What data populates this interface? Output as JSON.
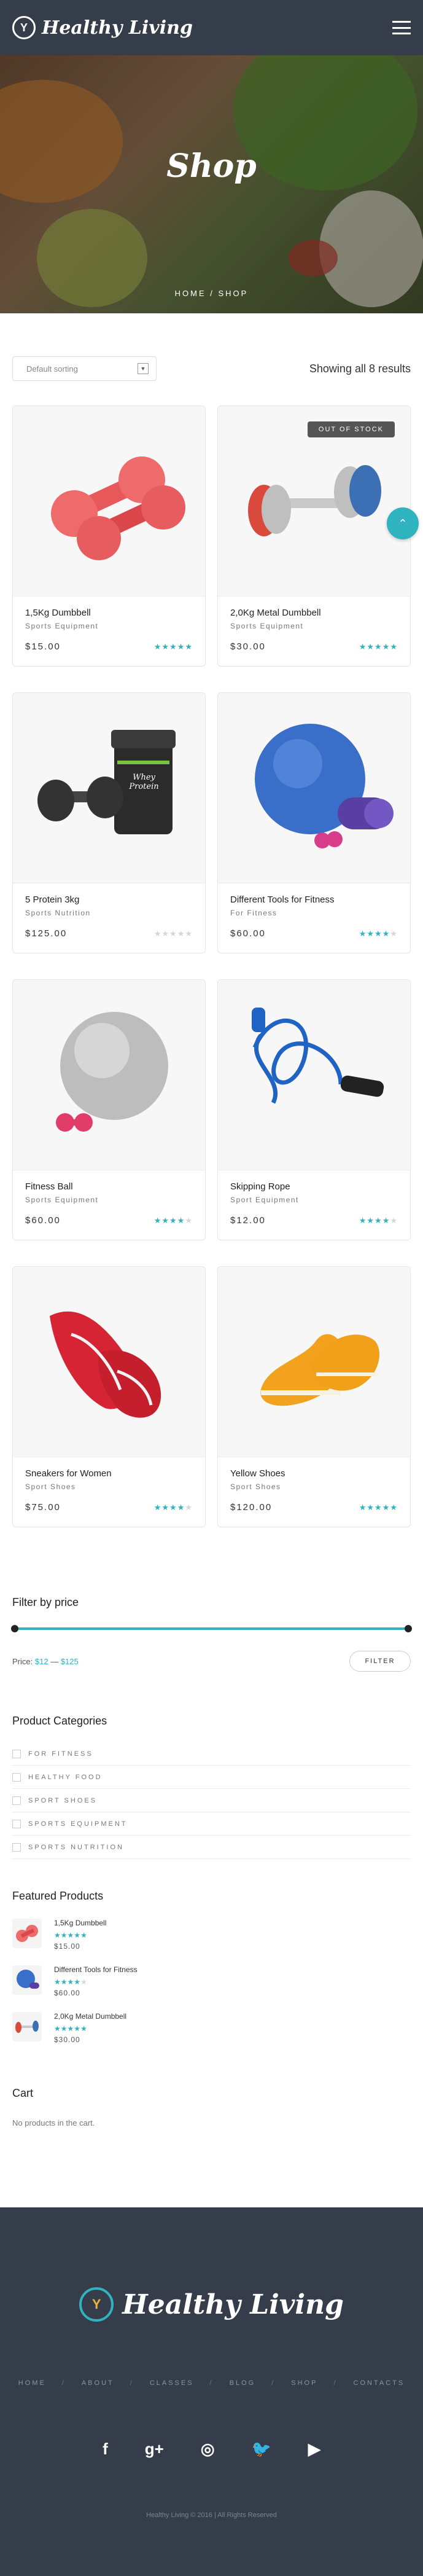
{
  "header": {
    "logo_text": "Healthy Living",
    "logo_mark": "Y",
    "menu_icon": "hamburger-icon"
  },
  "hero": {
    "title": "Shop",
    "breadcrumb": "HOME / SHOP"
  },
  "toolbar": {
    "sort_label": "Default sorting",
    "result_count": "Showing all 8 results"
  },
  "products": [
    {
      "name": "1,5Kg Dumbbell",
      "category": "Sports Equipment",
      "price": "$15.00",
      "rating": 5
    },
    {
      "name": "2,0Kg Metal Dumbbell",
      "category": "Sports Equipment",
      "price": "$30.00",
      "rating": 5,
      "badge": "OUT OF STOCK"
    },
    {
      "name": "5 Protein 3kg",
      "category": "Sports Nutrition",
      "price": "$125.00",
      "rating": 0
    },
    {
      "name": "Different Tools for Fitness",
      "category": "For Fitness",
      "price": "$60.00",
      "rating": 4
    },
    {
      "name": "Fitness Ball",
      "category": "Sports Equipment",
      "price": "$60.00",
      "rating": 4
    },
    {
      "name": "Skipping Rope",
      "category": "Sport Equipment",
      "price": "$12.00",
      "rating": 4
    },
    {
      "name": "Sneakers for Women",
      "category": "Sport Shoes",
      "price": "$75.00",
      "rating": 4
    },
    {
      "name": "Yellow Shoes",
      "category": "Sport Shoes",
      "price": "$120.00",
      "rating": 5
    }
  ],
  "protein_label": "Whey Protein",
  "filter": {
    "title": "Filter by price",
    "price_prefix": "Price:",
    "min": "$12",
    "dash": "—",
    "max": "$125",
    "button": "FILTER"
  },
  "categories": {
    "title": "Product Categories",
    "items": [
      "FOR FITNESS",
      "HEALTHY FOOD",
      "SPORT SHOES",
      "SPORTS EQUIPMENT",
      "SPORTS NUTRITION"
    ]
  },
  "featured": {
    "title": "Featured Products",
    "items": [
      {
        "name": "1,5Kg Dumbbell",
        "price": "$15.00",
        "rating": 5
      },
      {
        "name": "Different Tools for Fitness",
        "price": "$60.00",
        "rating": 4
      },
      {
        "name": "2,0Kg Metal Dumbbell",
        "price": "$30.00",
        "rating": 5
      }
    ]
  },
  "cart": {
    "title": "Cart",
    "empty": "No products in the cart."
  },
  "footer": {
    "logo_text": "Healthy Living",
    "logo_mark": "Y",
    "nav": [
      "HOME",
      "ABOUT",
      "CLASSES",
      "BLOG",
      "SHOP",
      "CONTACTS"
    ],
    "nav_sep": "/",
    "socials": [
      {
        "icon": "facebook-icon",
        "glyph": "f"
      },
      {
        "icon": "google-plus-icon",
        "glyph": "g+"
      },
      {
        "icon": "instagram-icon",
        "glyph": "◎"
      },
      {
        "icon": "twitter-icon",
        "glyph": "🐦"
      },
      {
        "icon": "youtube-icon",
        "glyph": "▶"
      }
    ],
    "copyright": "Healthy Living © 2016 | All Rights Reserved"
  },
  "colors": {
    "accent": "#2fb3bf",
    "header_bg": "#363d4a",
    "footer_bg": "#363d4a"
  }
}
